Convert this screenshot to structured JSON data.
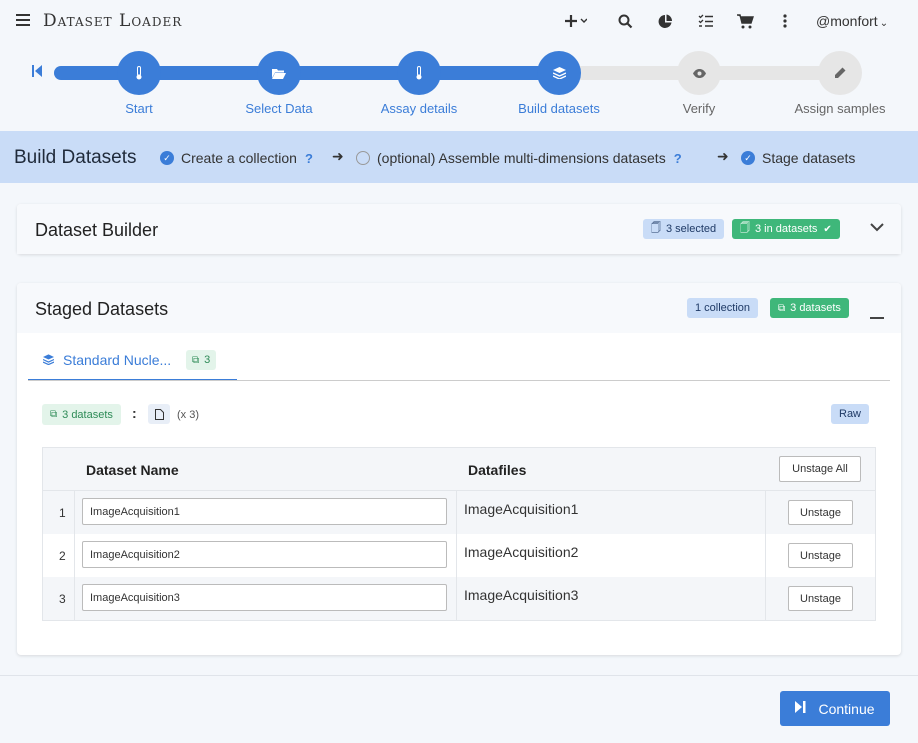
{
  "header": {
    "app_title": "Dataset Loader",
    "user": "@monfort",
    "icons": [
      "plus-icon",
      "search-icon",
      "pie-chart-icon",
      "task-list-icon",
      "cart-icon",
      "kebab-menu-icon"
    ]
  },
  "stepper": {
    "steps": [
      {
        "label": "Start",
        "icon": "thermometer-icon",
        "state": "done"
      },
      {
        "label": "Select Data",
        "icon": "folder-open-icon",
        "state": "done"
      },
      {
        "label": "Assay details",
        "icon": "thermometer-icon",
        "state": "done"
      },
      {
        "label": "Build datasets",
        "icon": "layers-icon",
        "state": "done"
      },
      {
        "label": "Verify",
        "icon": "eye-icon",
        "state": "todo"
      },
      {
        "label": "Assign samples",
        "icon": "pencil-icon",
        "state": "todo"
      }
    ]
  },
  "build_bar": {
    "title": "Build Datasets",
    "crumbs": [
      {
        "label": "Create a collection",
        "checked": true,
        "help": "?"
      },
      {
        "label": "(optional) Assemble multi-dimensions datasets",
        "checked": false,
        "help": "?"
      },
      {
        "label": "Stage datasets",
        "checked": true,
        "help": ""
      }
    ]
  },
  "dataset_builder": {
    "title": "Dataset Builder",
    "badge_selected": "3 selected",
    "badge_in_datasets": "3 in datasets"
  },
  "staged": {
    "title": "Staged Datasets",
    "badge_collection": "1 collection",
    "badge_datasets": "3 datasets",
    "tab": {
      "label": "Standard Nucle...",
      "count": "3"
    },
    "summary": {
      "datasets": "3 datasets",
      "colon": ":",
      "multiplier": "(x 3)",
      "raw": "Raw"
    },
    "table": {
      "col_name": "Dataset Name",
      "col_files": "Datafiles",
      "unstage_all": "Unstage All",
      "rows": [
        {
          "num": "1",
          "name": "ImageAcquisition1",
          "file": "ImageAcquisition1",
          "action": "Unstage"
        },
        {
          "num": "2",
          "name": "ImageAcquisition2",
          "file": "ImageAcquisition2",
          "action": "Unstage"
        },
        {
          "num": "3",
          "name": "ImageAcquisition3",
          "file": "ImageAcquisition3",
          "action": "Unstage"
        }
      ]
    }
  },
  "footer": {
    "continue_label": "Continue"
  },
  "colors": {
    "primary": "#3b7dd8",
    "success": "#3fb77a",
    "info_bg": "#c9dcf7"
  }
}
